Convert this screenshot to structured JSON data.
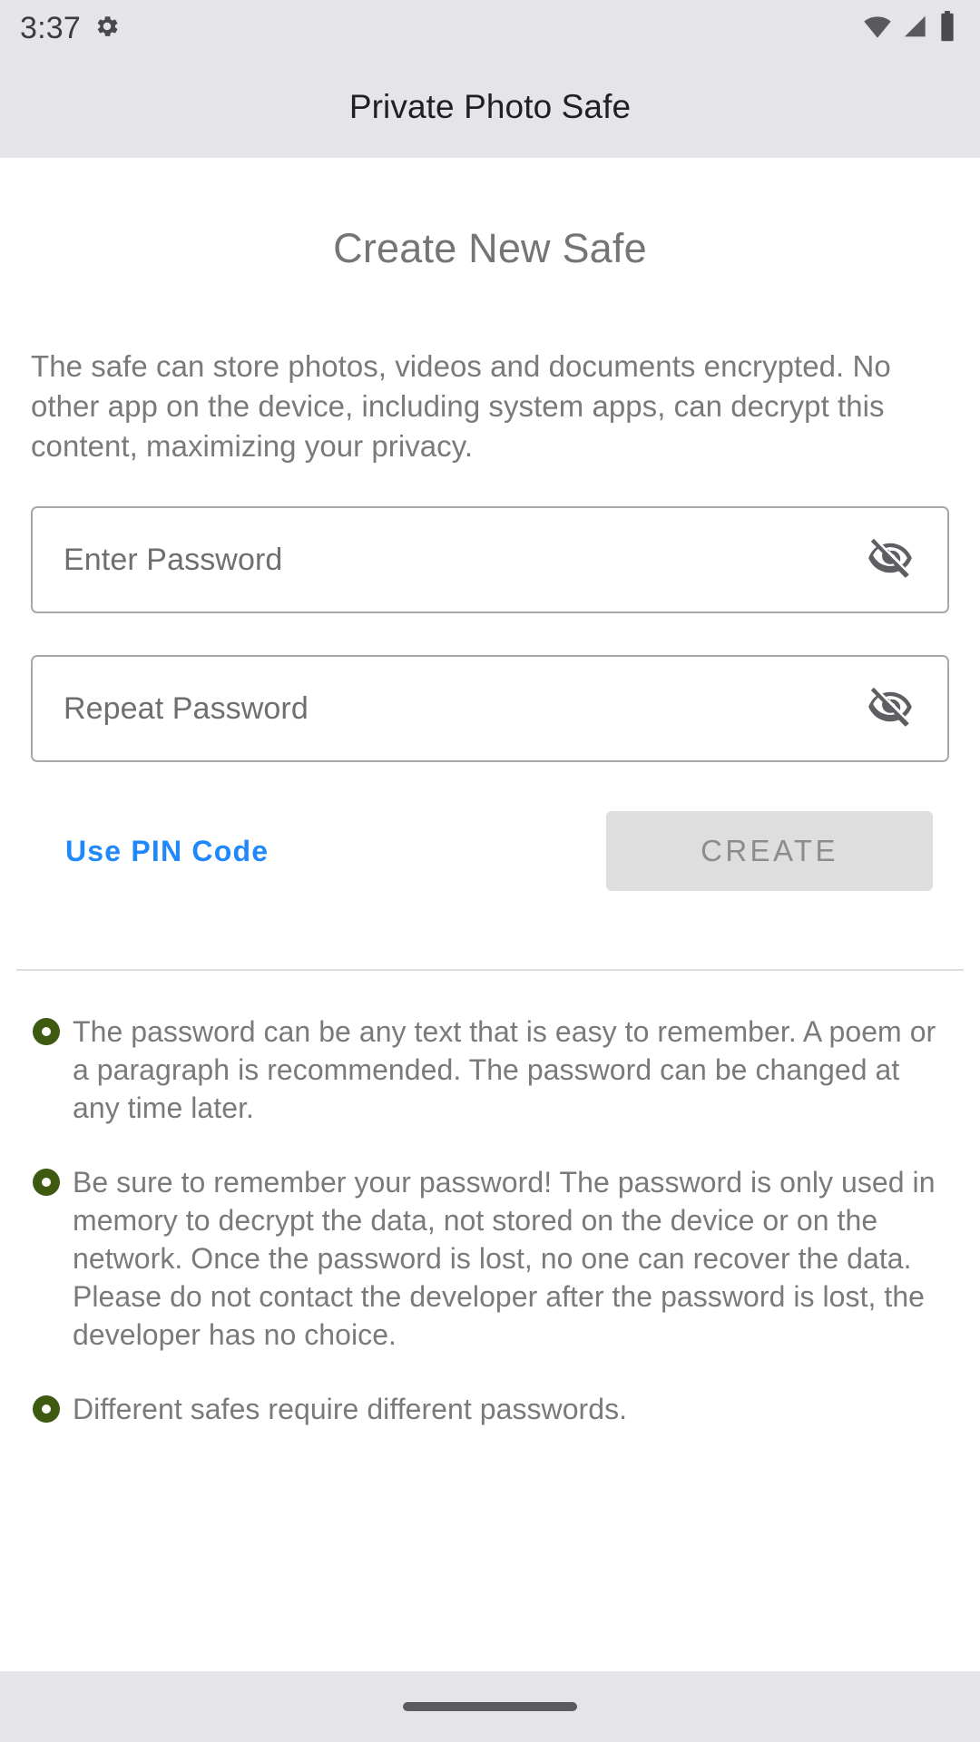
{
  "statusbar": {
    "clock": "3:37",
    "icons": {
      "settings": "gear-icon",
      "wifi": "wifi-icon",
      "signal": "cellular-signal-icon",
      "battery": "battery-full-icon"
    }
  },
  "appbar": {
    "title": "Private Photo Safe"
  },
  "screen": {
    "title": "Create New Safe",
    "intro": "The safe can store photos, videos and documents encrypted. No other app on the device, including system apps, can decrypt this content, maximizing your privacy."
  },
  "fields": [
    {
      "name": "password",
      "placeholder": "Enter Password",
      "value": "",
      "toggle_icon": "eye-off-icon"
    },
    {
      "name": "repeat-password",
      "placeholder": "Repeat Password",
      "value": "",
      "toggle_icon": "eye-off-icon"
    }
  ],
  "actions": {
    "pin_link": "Use PIN Code",
    "pin_link_color": "#1f88fb",
    "create_label": "CREATE",
    "create_enabled": false,
    "create_bg": "#dededf",
    "create_text_color": "#8c8c8f"
  },
  "tips": {
    "bullet_color": "#3e5a10",
    "items": [
      "The password can be any text that is easy to remember. A poem or a paragraph is recommended. The password can be changed at any time later.",
      "Be sure to remember your password! The password is only used in memory to decrypt the data, not stored on the device or on the network. Once the password is lost, no one can recover the data. Please do not contact the developer after the password is lost, the developer has no choice.",
      "Different safes require different passwords."
    ]
  },
  "navbar": {
    "home_pill": "home-indicator"
  }
}
